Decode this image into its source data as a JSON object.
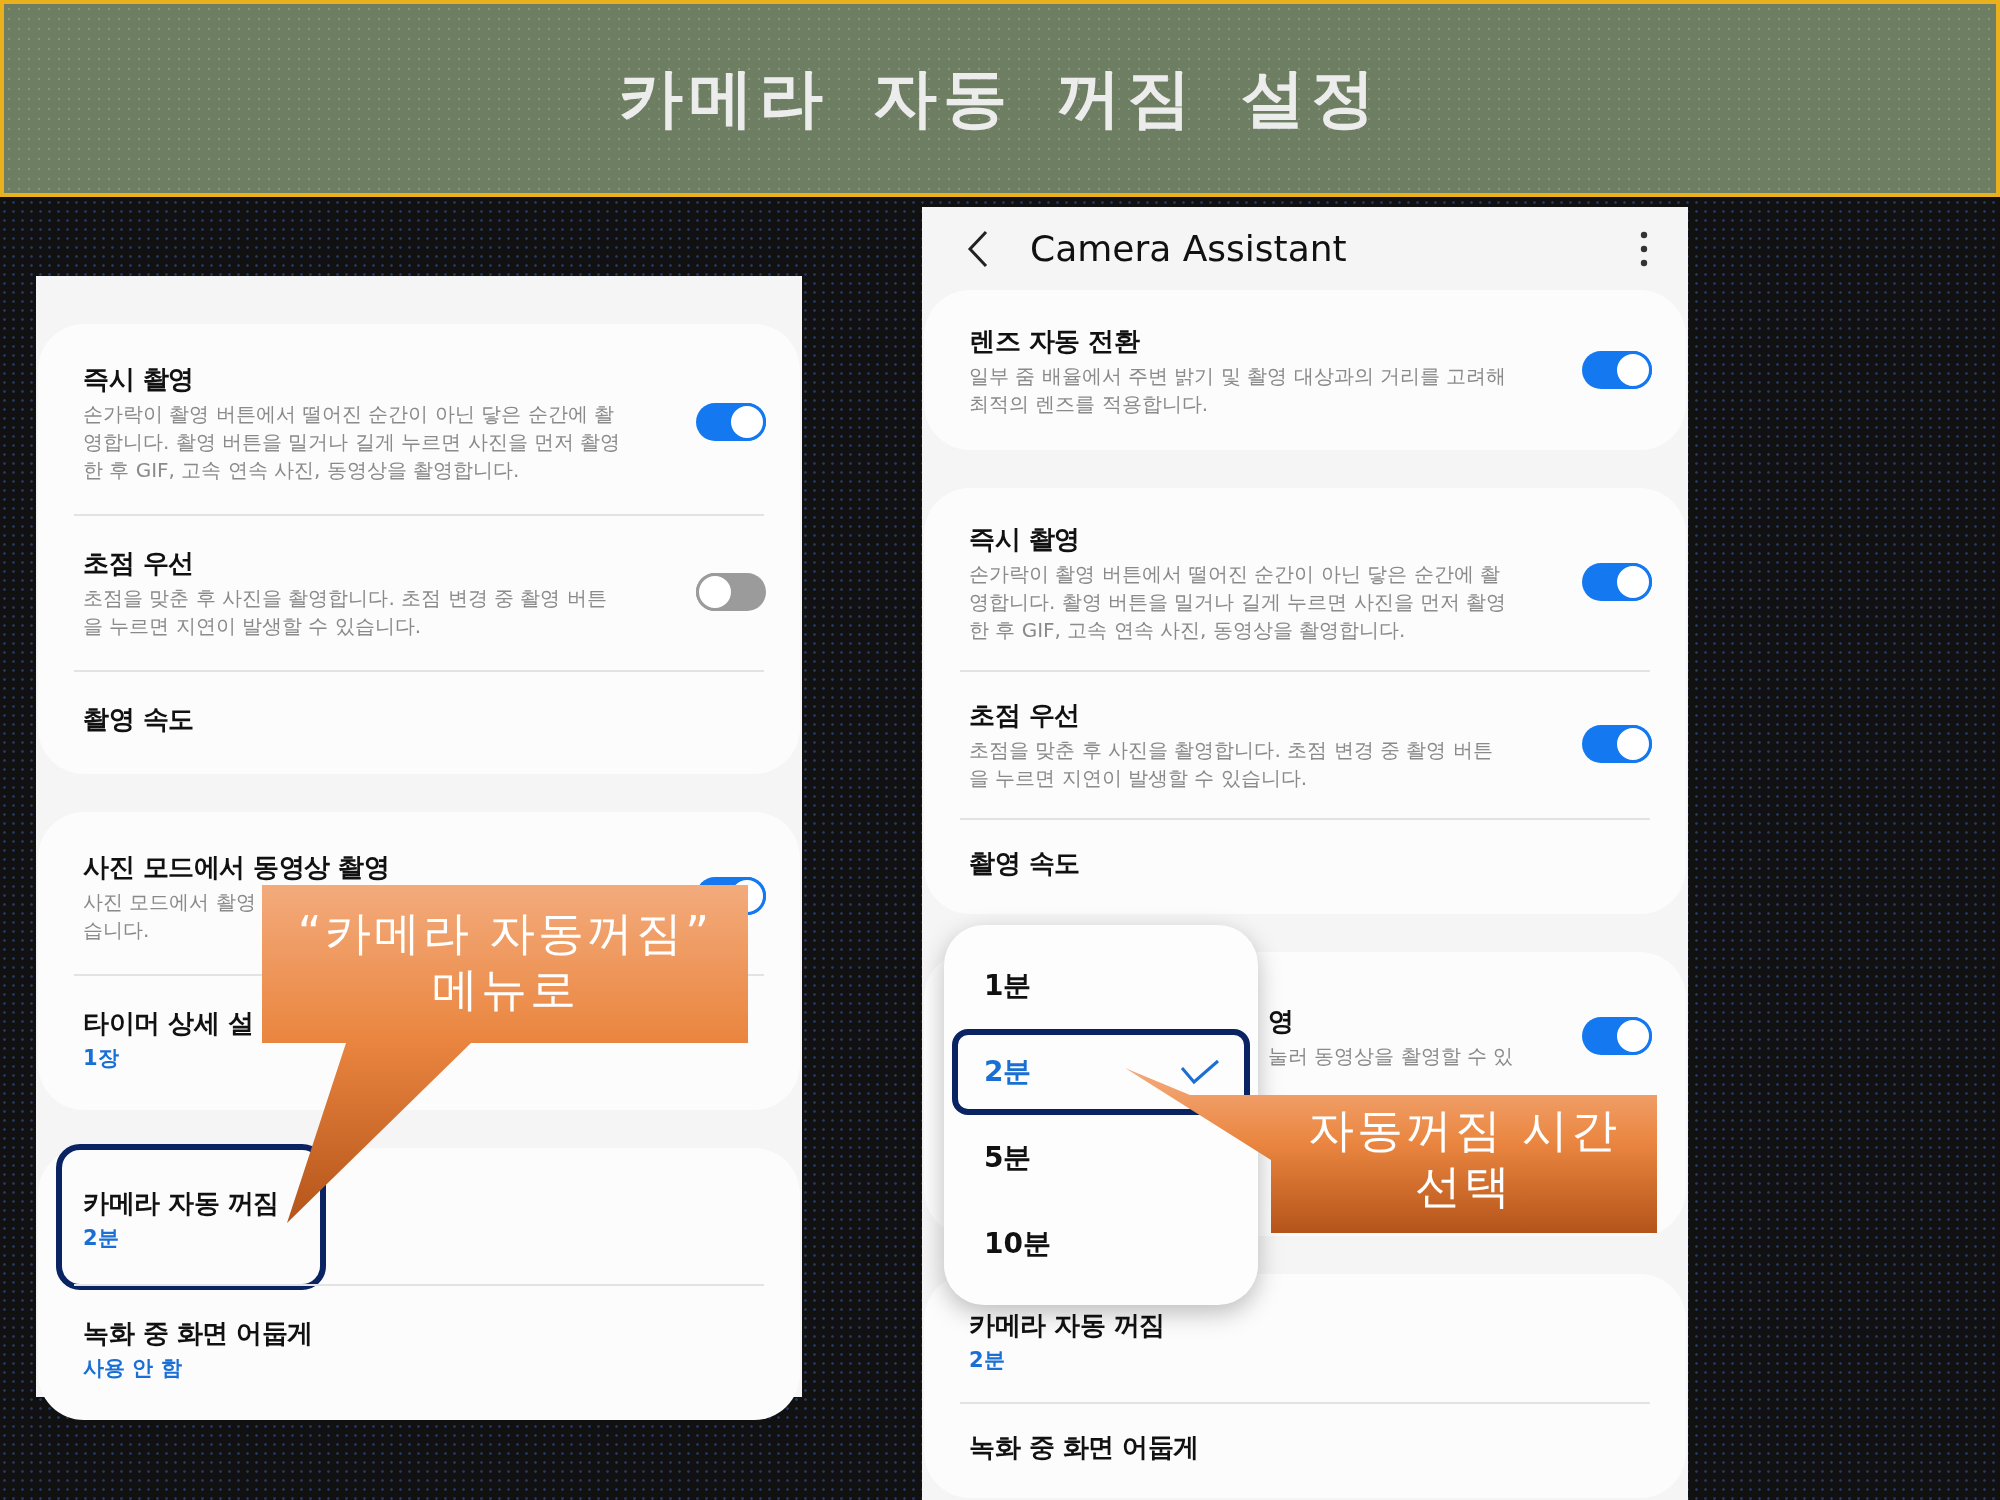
{
  "banner": {
    "title": "카메라 자동 꺼짐 설정"
  },
  "left_screen": {
    "groups": [
      {
        "items": [
          {
            "title": "즉시 촬영",
            "description": "손가락이 촬영 버튼에서 떨어진 순간이 아닌 닿은 순간에 촬\n영합니다. 촬영 버튼을 밀거나 길게 누르면 사진을 먼저 촬영\n한 후 GIF, 고속 연속 사진, 동영상을 촬영합니다.",
            "toggle": {
              "on": true
            }
          },
          {
            "title": "초점 우선",
            "description": "초점을 맞춘 후 사진을 촬영합니다. 초점 변경 중 촬영 버튼\n을 누르면 지연이 발생할 수 있습니다.",
            "toggle": {
              "on": false
            }
          },
          {
            "title": "촬영 속도"
          }
        ]
      },
      {
        "items": [
          {
            "title": "사진 모드에서 동영상 촬영",
            "description": "사진 모드에서 촬영\n습니다.",
            "toggle": {
              "on": true
            }
          },
          {
            "title": "타이머 상세 설",
            "value": "1장"
          }
        ]
      },
      {
        "items": [
          {
            "title": "카메라 자동 꺼짐",
            "value": "2분",
            "highlighted": true
          },
          {
            "title": "녹화 중 화면 어둡게",
            "value": "사용 안 함"
          }
        ]
      }
    ]
  },
  "right_screen": {
    "header": {
      "title": "Camera Assistant"
    },
    "groups": [
      {
        "items": [
          {
            "title": "렌즈 자동 전환",
            "description": "일부 줌 배율에서 주변 밝기 및 촬영 대상과의 거리를 고려해\n최적의 렌즈를 적용합니다.",
            "toggle": {
              "on": true
            }
          }
        ]
      },
      {
        "items": [
          {
            "title": "즉시 촬영",
            "description": "손가락이 촬영 버튼에서 떨어진 순간이 아닌 닿은 순간에 촬\n영합니다. 촬영 버튼을 밀거나 길게 누르면 사진을 먼저 촬영\n한 후 GIF, 고속 연속 사진, 동영상을 촬영합니다.",
            "toggle": {
              "on": true
            }
          },
          {
            "title": "초점 우선",
            "description": "초점을 맞춘 후 사진을 촬영합니다. 초점 변경 중 촬영 버튼\n을 누르면 지연이 발생할 수 있습니다.",
            "toggle": {
              "on": true
            }
          },
          {
            "title": "촬영 속도"
          }
        ]
      },
      {
        "items": [
          {
            "title": "영",
            "description": "눌러 동영상을 촬영할 수 있",
            "toggle": {
              "on": true
            },
            "covered": true
          }
        ]
      },
      {
        "items": [
          {
            "title": "카메라 자동 꺼짐",
            "value": "2분"
          },
          {
            "title": "녹화 중 화면 어둡게"
          }
        ]
      }
    ],
    "menu": {
      "options": [
        {
          "label": "1분",
          "selected": false
        },
        {
          "label": "2분",
          "selected": true
        },
        {
          "label": "5분",
          "selected": false
        },
        {
          "label": "10분",
          "selected": false
        }
      ]
    }
  },
  "callouts": [
    {
      "text": "“카메라 자동꺼짐”\n메뉴로"
    },
    {
      "text": "자동꺼짐 시간\n선택"
    }
  ]
}
